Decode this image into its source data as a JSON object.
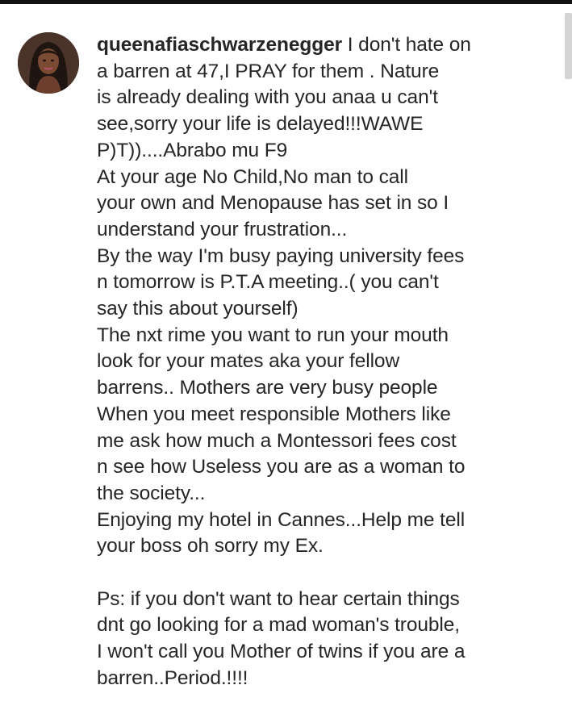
{
  "comment": {
    "username": "queenafiaschwarzenegger",
    "first_line_rest": " I don't hate on",
    "lines": [
      "a barren at 47,I PRAY  for them . Nature",
      "is already dealing with you anaa u can't",
      "see,sorry your life is delayed!!!WAWE",
      "P)T))....Abrabo mu  F9",
      "At your age  No Child,No man to call",
      "your own and Menopause has set in so I",
      "understand your frustration...",
      "By the way I'm busy paying university fees",
      "n tomorrow is P.T.A meeting..( you can't",
      "say this about yourself)",
      "The nxt rime you want to run your  mouth",
      "look for your mates aka your fellow",
      "barrens.. Mothers are very busy people",
      "When you  meet responsible Mothers like",
      "me ask how much a  Montessori fees cost",
      "n see how Useless you are as a woman to",
      "the society...",
      "Enjoying my hotel in Cannes...Help me tell",
      "your boss oh sorry my Ex."
    ],
    "ps_lines": [
      "Ps: if you don't want to hear certain things",
      "dnt go looking for a mad woman's trouble,",
      "I won't call you Mother of twins if you are a",
      "barren..Period.!!!!"
    ]
  },
  "colors": {
    "text": "#262626",
    "background": "#ffffff",
    "top_rule": "#111111"
  }
}
